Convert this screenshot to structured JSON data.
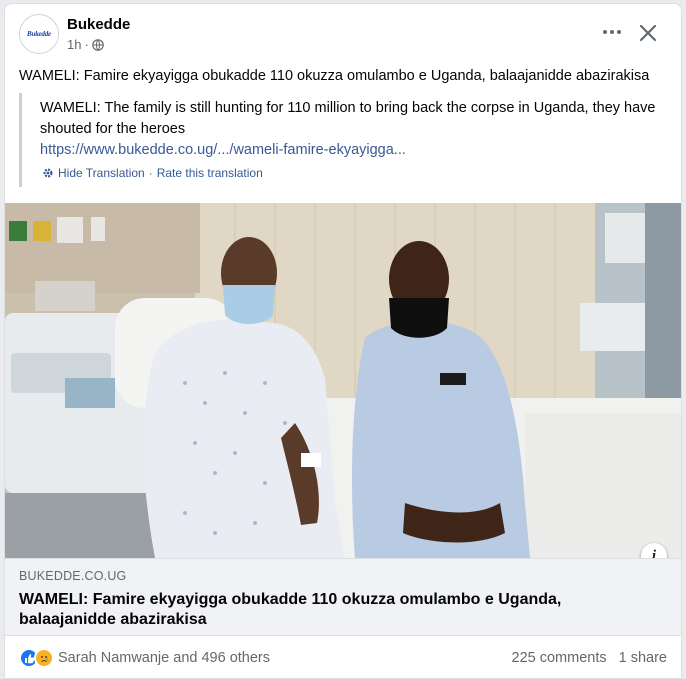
{
  "post": {
    "page_name": "Bukedde",
    "avatar_text": "Bukedde",
    "time": "1h",
    "privacy_icon": "globe-icon",
    "text": "WAMELI: Famire ekyayigga obukadde 110 okuzza omulambo e Uganda, balaajanidde abazirakisa"
  },
  "translation": {
    "text": "WAMELI: The family is still hunting for 110 million to bring back the corpse in Uganda, they have shouted for the heroes",
    "link": "https://www.bukedde.co.ug/.../wameli-famire-ekyayigga...",
    "hide_label": "Hide Translation",
    "separator": "·",
    "rate_label": "Rate this translation"
  },
  "link_preview": {
    "domain": "BUKEDDE.CO.UG",
    "title": "WAMELI: Famire ekyayigga obukadde 110 okuzza omulambo e Uganda, balaajanidde abazirakisa"
  },
  "stats": {
    "reaction_icons": [
      "like-icon",
      "sad-icon"
    ],
    "reactors": "Sarah Namwanje and 496 others",
    "comments": "225 comments",
    "shares": "1 share"
  },
  "colors": {
    "link": "#385898",
    "like": "#1877f2",
    "sad": "#f7b125",
    "secondary_text": "#65676b"
  }
}
